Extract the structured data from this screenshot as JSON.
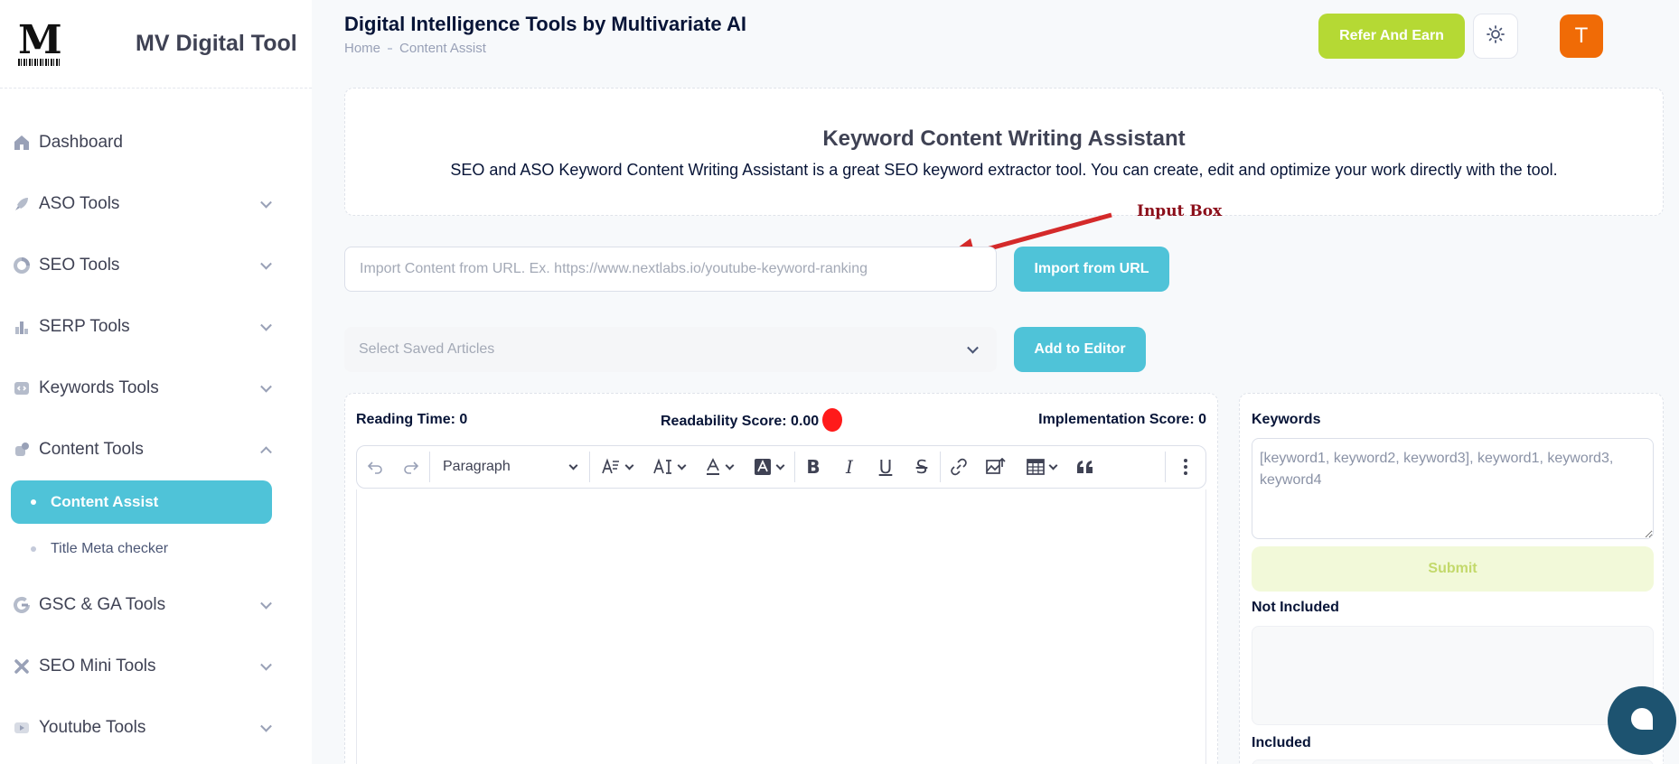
{
  "brand": {
    "name": "MV Digital Tool",
    "logo_letter": "M"
  },
  "sidebar": {
    "items": [
      {
        "label": "Dashboard",
        "icon": "home-icon"
      },
      {
        "label": "ASO Tools",
        "icon": "rocket-icon"
      },
      {
        "label": "SEO Tools",
        "icon": "pie-chart-icon"
      },
      {
        "label": "SERP Tools",
        "icon": "chart-bar-icon"
      },
      {
        "label": "Keywords Tools",
        "icon": "code-window-icon"
      },
      {
        "label": "Content Tools",
        "icon": "brush-icon",
        "expanded": true
      },
      {
        "label": "GSC & GA Tools",
        "icon": "google-icon"
      },
      {
        "label": "SEO Mini Tools",
        "icon": "cross-tools-icon"
      },
      {
        "label": "Youtube Tools",
        "icon": "youtube-icon"
      }
    ],
    "content_sub": [
      {
        "label": "Content Assist",
        "active": true
      },
      {
        "label": "Title Meta checker",
        "active": false
      }
    ]
  },
  "header": {
    "title": "Digital Intelligence Tools by Multivariate AI",
    "breadcrumb": [
      "Home",
      "Content Assist"
    ],
    "refer_label": "Refer And Earn",
    "avatar_letter": "T"
  },
  "intro": {
    "title": "Keyword Content Writing Assistant",
    "description": "SEO and ASO Keyword Content Writing Assistant is a great SEO keyword extractor tool. You can create, edit and optimize your work directly with the tool."
  },
  "annotation": {
    "label": "Input Box"
  },
  "import": {
    "placeholder": "Import Content from URL. Ex. https://www.nextlabs.io/youtube-keyword-ranking",
    "button": "Import from URL"
  },
  "saved": {
    "placeholder": "Select Saved Articles",
    "button": "Add to Editor"
  },
  "editor": {
    "reading_time": "Reading Time: 0",
    "readability": "Readability Score: 0.00",
    "implementation": "Implementation Score: 0",
    "block_type": "Paragraph"
  },
  "keywords": {
    "title": "Keywords",
    "placeholder": "[keyword1, keyword2, keyword3], keyword1, keyword3, keyword4",
    "submit": "Submit",
    "not_included": "Not Included",
    "included": "Included"
  },
  "colors": {
    "accent": "#4fc3d8",
    "refer": "#b5d934",
    "avatar": "#f06b06",
    "readability_status": "#ff1a1a",
    "annotation": "#d42a2a",
    "chat": "#1d5370"
  }
}
